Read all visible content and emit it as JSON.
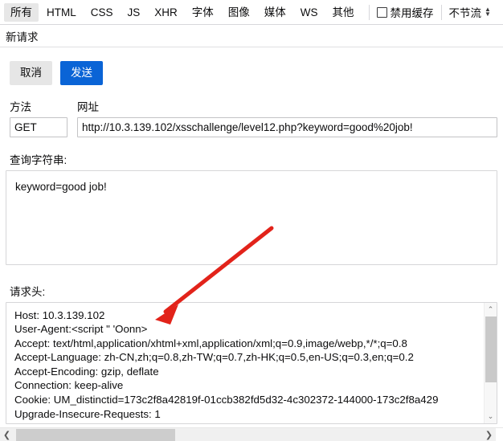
{
  "toolbar": {
    "filters": [
      {
        "label": "所有",
        "active": true
      },
      {
        "label": "HTML",
        "active": false
      },
      {
        "label": "CSS",
        "active": false
      },
      {
        "label": "JS",
        "active": false
      },
      {
        "label": "XHR",
        "active": false
      },
      {
        "label": "字体",
        "active": false
      },
      {
        "label": "图像",
        "active": false
      },
      {
        "label": "媒体",
        "active": false
      },
      {
        "label": "WS",
        "active": false
      },
      {
        "label": "其他",
        "active": false
      }
    ],
    "disable_cache_label": "禁用缓存",
    "disable_cache_checked": false,
    "throttle_value": "不节流",
    "stepper_up_icon": "▲",
    "stepper_down_icon": "▼"
  },
  "panel": {
    "title": "新请求",
    "cancel_label": "取消",
    "send_label": "发送",
    "method_label": "方法",
    "method_value": "GET",
    "url_label": "网址",
    "url_value": "http://10.3.139.102/xsschallenge/level12.php?keyword=good%20job!",
    "query_label": "查询字符串:",
    "query_value": "keyword=good job!",
    "headers_label": "请求头:",
    "headers_value": "Host: 10.3.139.102\nUser-Agent:<script \" 'Oonn>\nAccept: text/html,application/xhtml+xml,application/xml;q=0.9,image/webp,*/*;q=0.8\nAccept-Language: zh-CN,zh;q=0.8,zh-TW;q=0.7,zh-HK;q=0.5,en-US;q=0.3,en;q=0.2\nAccept-Encoding: gzip, deflate\nConnection: keep-alive\nCookie: UM_distinctid=173c2f8a42819f-01ccb382fd5d32-4c302372-144000-173c2f8a429\nUpgrade-Insecure-Requests: 1"
  },
  "scrollbars": {
    "v_up_icon": "⌃",
    "v_down_icon": "⌄",
    "h_left_icon": "❮",
    "h_right_icon": "❯"
  },
  "annotation": {
    "color": "#e2231a",
    "description": "red-arrow pointing to User-Agent header"
  }
}
